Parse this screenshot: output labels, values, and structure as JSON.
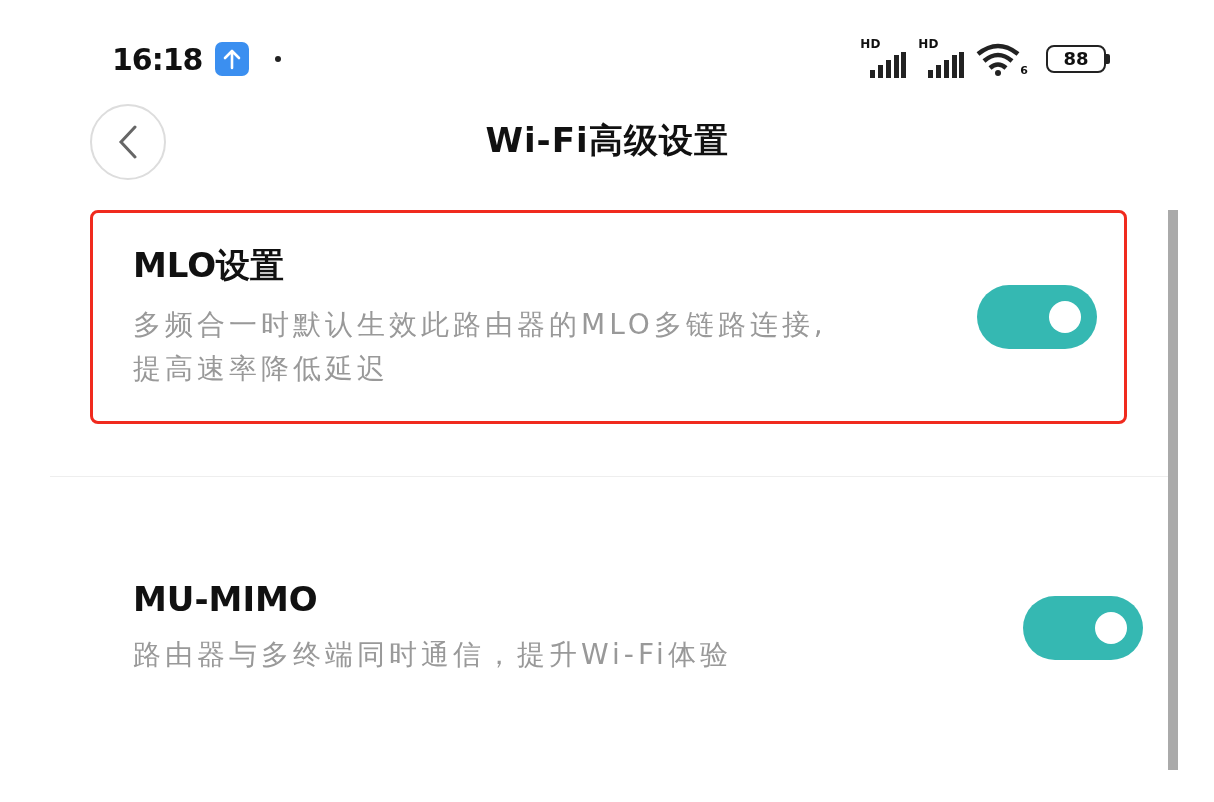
{
  "status_bar": {
    "time": "16:18",
    "signal_labels": [
      "HD",
      "HD"
    ],
    "wifi_label": "6",
    "battery": "88"
  },
  "header": {
    "title": "Wi-Fi高级设置"
  },
  "settings": [
    {
      "title": "MLO设置",
      "description": "多频合一时默认生效此路由器的MLO多链路连接,提高速率降低延迟",
      "on": true,
      "highlighted": true
    },
    {
      "title": "MU-MIMO",
      "description": "路由器与多终端同时通信，提升Wi-Fi体验",
      "on": true,
      "highlighted": false
    }
  ]
}
